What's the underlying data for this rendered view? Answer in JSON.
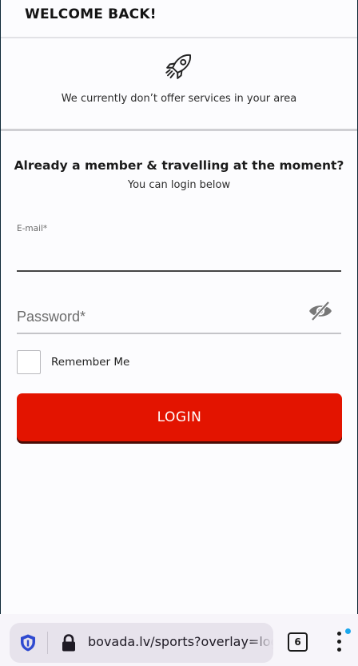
{
  "header": {
    "title": "WELCOME BACK!"
  },
  "notice": {
    "icon": "rocket-icon",
    "text": "We currently don’t offer services in your area"
  },
  "login": {
    "heading": "Already a member & travelling at the moment?",
    "subheading": "You can login below",
    "email": {
      "label": "E-mail*",
      "value": ""
    },
    "password": {
      "placeholder": "Password*",
      "value": "",
      "toggle_icon": "eye-off-icon"
    },
    "remember_label": "Remember Me",
    "remember_checked": false,
    "button_label": "LOGIN",
    "button_color": "#e31400"
  },
  "browser": {
    "url": "bovada.lv/sports?overlay=login",
    "tab_count": "6",
    "shield_icon": "shield-icon",
    "lock_icon": "lock-icon",
    "menu_icon": "more-vertical-icon"
  }
}
